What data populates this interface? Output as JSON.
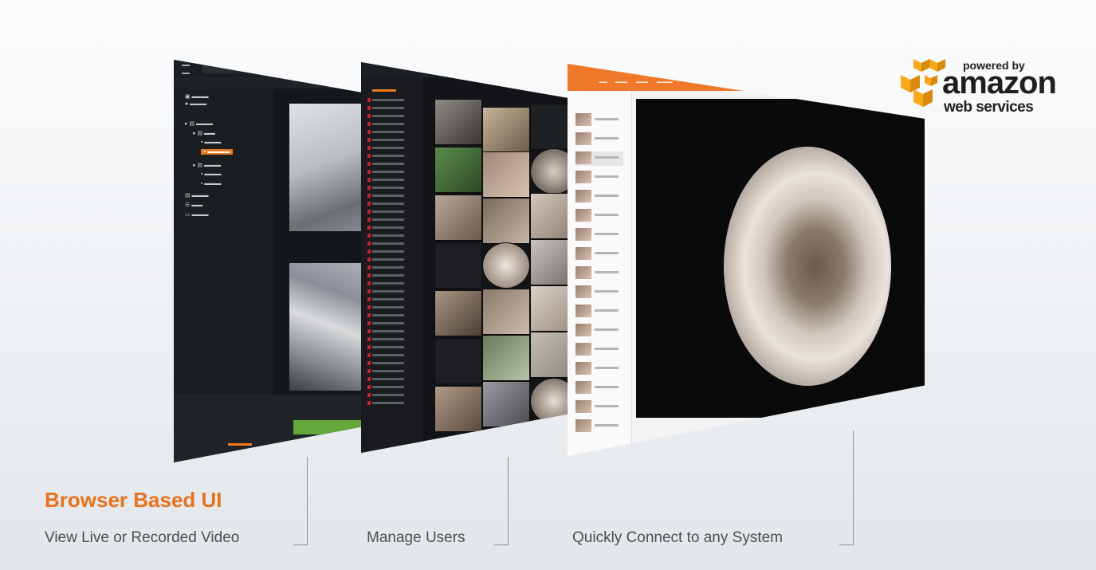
{
  "badge": {
    "powered_by": "powered by",
    "amazon": "amazon",
    "web_services": "web services"
  },
  "headline": "Browser Based UI",
  "captions": [
    "View Live or Recorded Video",
    "Manage Users",
    "Quickly Connect to any System"
  ],
  "colors": {
    "accent_orange": "#e8711b",
    "caption_gray": "#4a4f55",
    "app_header_orange": "#f0782a",
    "timeline_green": "#67a83d"
  }
}
